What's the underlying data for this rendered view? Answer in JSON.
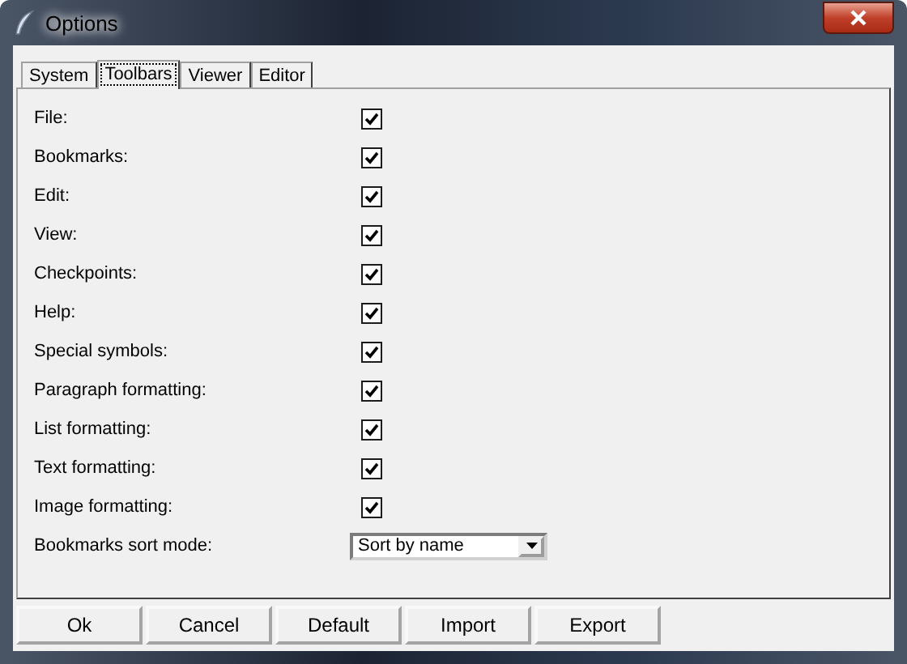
{
  "window": {
    "title": "Options"
  },
  "tabs": [
    {
      "label": "System",
      "selected": false
    },
    {
      "label": "Toolbars",
      "selected": true
    },
    {
      "label": "Viewer",
      "selected": false
    },
    {
      "label": "Editor",
      "selected": false
    }
  ],
  "options": [
    {
      "label": "File:",
      "checked": true
    },
    {
      "label": "Bookmarks:",
      "checked": true
    },
    {
      "label": "Edit:",
      "checked": true
    },
    {
      "label": "View:",
      "checked": true
    },
    {
      "label": "Checkpoints:",
      "checked": true
    },
    {
      "label": "Help:",
      "checked": true
    },
    {
      "label": "Special symbols:",
      "checked": true
    },
    {
      "label": "Paragraph formatting:",
      "checked": true
    },
    {
      "label": "List formatting:",
      "checked": true
    },
    {
      "label": "Text formatting:",
      "checked": true
    },
    {
      "label": "Image formatting:",
      "checked": true
    }
  ],
  "sort_mode": {
    "label": "Bookmarks sort mode:",
    "value": "Sort by name"
  },
  "buttons": [
    "Ok",
    "Cancel",
    "Default",
    "Import",
    "Export"
  ]
}
